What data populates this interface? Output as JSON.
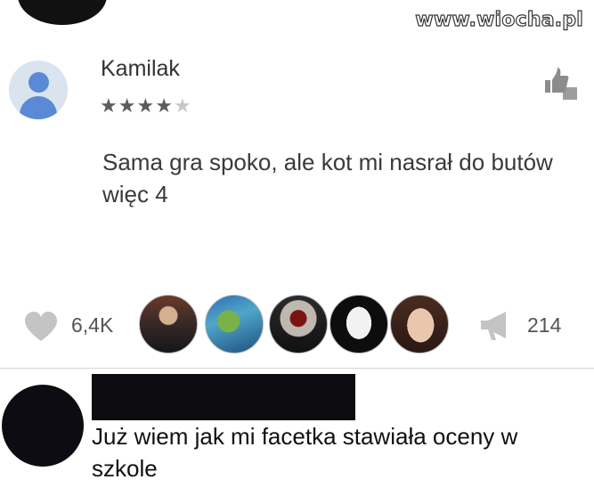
{
  "watermark": "www.wiocha.pl",
  "review": {
    "author": "Kamilak",
    "rating": 4,
    "rating_max": 5,
    "text": "Sama gra spoko, ale kot mi nasrał do butów więc 4"
  },
  "reactions": {
    "likes": "6,4K",
    "shares": "214"
  },
  "icons": {
    "like": "heart-icon",
    "share": "megaphone-icon",
    "rate": "thumbs-up-down-icon"
  },
  "comment": {
    "text": "Już wiem jak mi facetka stawiała oceny w szkole"
  }
}
